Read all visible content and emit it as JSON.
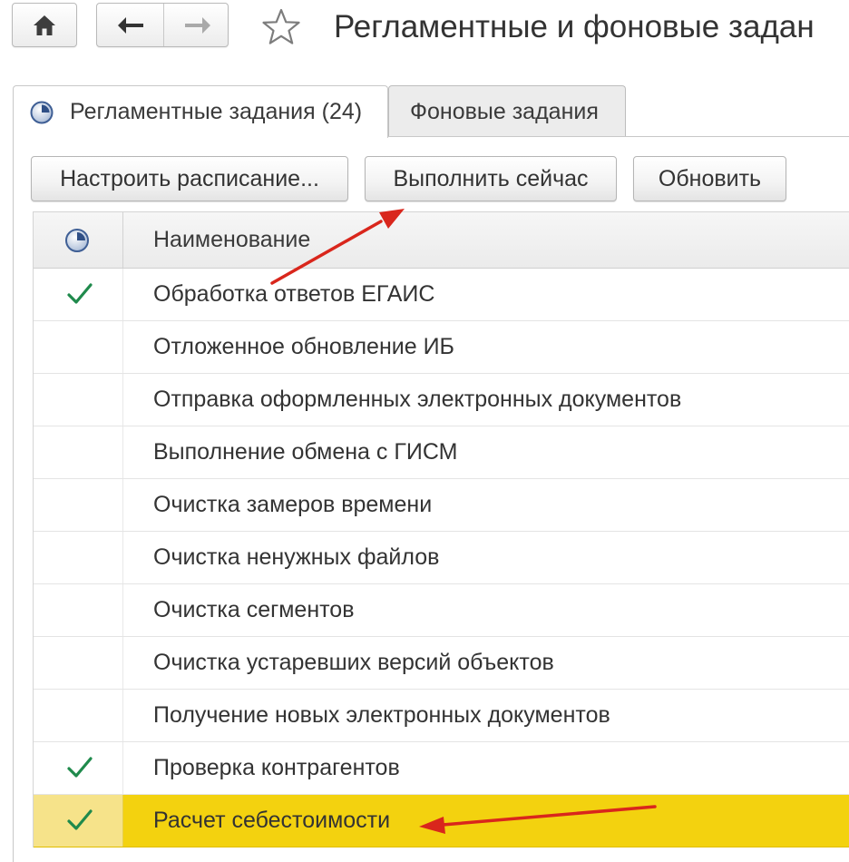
{
  "header": {
    "title": "Регламентные и фоновые задан",
    "home_icon": "home-icon",
    "back_icon": "arrow-left-icon",
    "forward_icon": "arrow-right-icon",
    "favorite_icon": "star-icon"
  },
  "tabs": [
    {
      "label": "Регламентные задания (24)",
      "icon": "clock-icon",
      "active": true
    },
    {
      "label": "Фоновые задания",
      "active": false
    }
  ],
  "toolbar": {
    "schedule_label": "Настроить расписание...",
    "run_now_label": "Выполнить сейчас",
    "refresh_label": "Обновить"
  },
  "table": {
    "status_column_icon": "clock-icon",
    "name_column_label": "Наименование",
    "rows": [
      {
        "name": "Обработка ответов ЕГАИС",
        "checked": true,
        "selected": false
      },
      {
        "name": "Отложенное обновление ИБ",
        "checked": false,
        "selected": false
      },
      {
        "name": "Отправка оформленных электронных документов",
        "checked": false,
        "selected": false
      },
      {
        "name": "Выполнение обмена с ГИСМ",
        "checked": false,
        "selected": false
      },
      {
        "name": "Очистка замеров времени",
        "checked": false,
        "selected": false
      },
      {
        "name": "Очистка ненужных файлов",
        "checked": false,
        "selected": false
      },
      {
        "name": "Очистка сегментов",
        "checked": false,
        "selected": false
      },
      {
        "name": "Очистка устаревших версий объектов",
        "checked": false,
        "selected": false
      },
      {
        "name": "Получение новых электронных документов",
        "checked": false,
        "selected": false
      },
      {
        "name": "Проверка контрагентов",
        "checked": true,
        "selected": false
      },
      {
        "name": "Расчет себестоимости",
        "checked": true,
        "selected": true
      }
    ]
  },
  "colors": {
    "selected_row": "#f3d20f",
    "check": "#1f8a4c",
    "annotation_arrow": "#d9261c"
  }
}
